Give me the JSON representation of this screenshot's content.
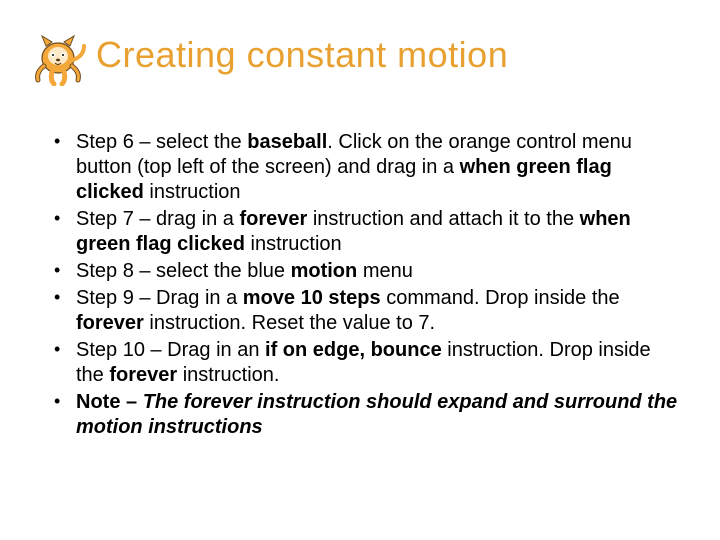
{
  "title": "Creating constant motion",
  "steps": [
    {
      "prefix": "Step 6 – select the ",
      "bold1": "baseball",
      "mid1": ". Click on the orange control menu button (top left of the screen) and drag in a ",
      "bold2": "when green flag clicked ",
      "tail": "instruction"
    },
    {
      "prefix": "Step 7 – drag in a ",
      "bold1": "forever ",
      "mid1": "instruction and attach it to the ",
      "bold2": "when green flag clicked ",
      "tail": "instruction"
    },
    {
      "prefix": "Step 8 – select the blue ",
      "bold1": "motion ",
      "tail": "menu"
    },
    {
      "prefix": "Step 9 – Drag in a ",
      "bold1": "move 10 steps ",
      "mid1": "command. Drop inside the ",
      "bold2": "forever ",
      "tail": "instruction. Reset the value to 7."
    },
    {
      "prefix": "Step 10 – Drag in an ",
      "bold1": "if on edge, bounce ",
      "mid1": "instruction. Drop inside the ",
      "bold2": "forever ",
      "tail": "instruction."
    },
    {
      "noteLabel": "Note – ",
      "noteBody": "The forever instruction should expand and surround the motion instructions"
    }
  ]
}
